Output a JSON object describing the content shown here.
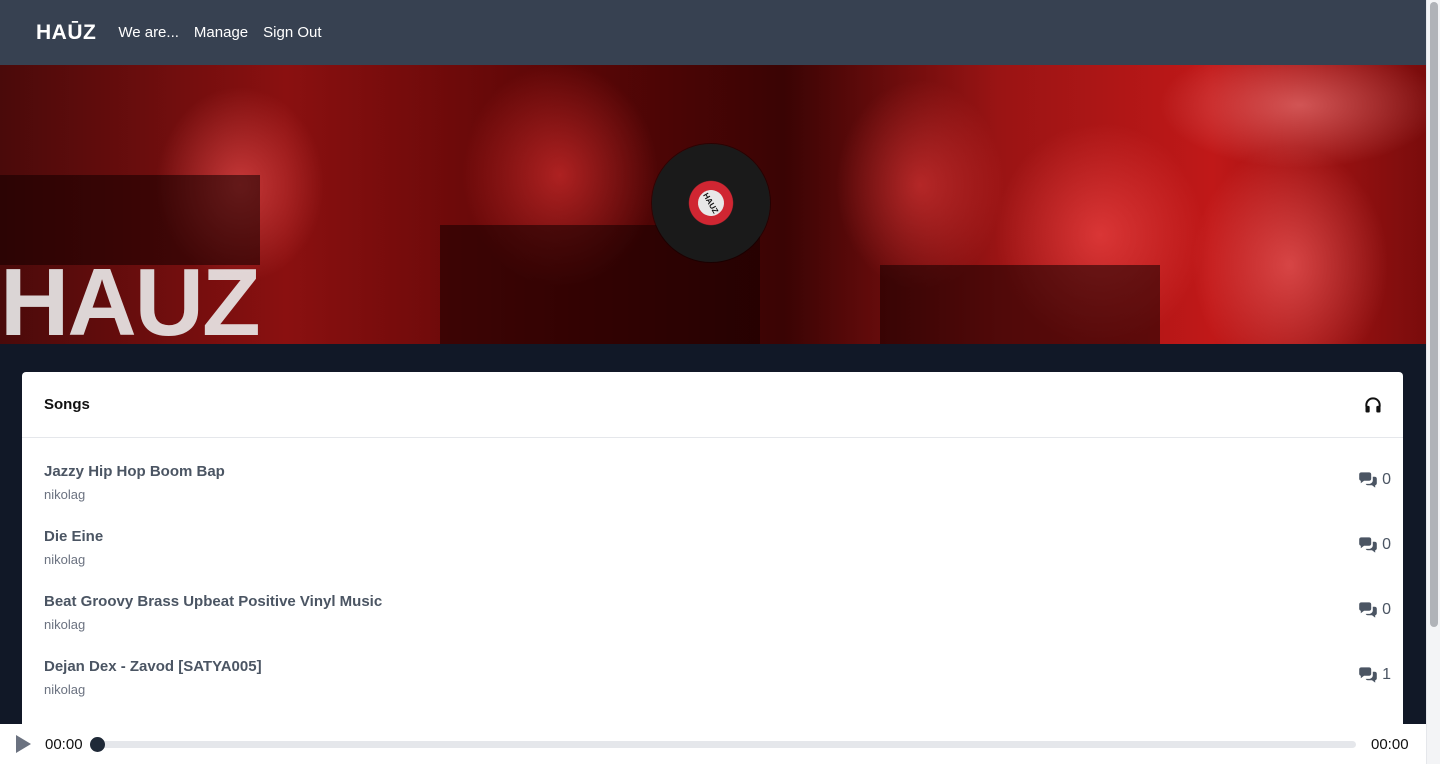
{
  "nav": {
    "brand": "HAŪZ",
    "links": [
      "We are...",
      "Manage",
      "Sign Out"
    ]
  },
  "hero": {
    "logo_text": "HAUZ",
    "vinyl_label": "HAUZ"
  },
  "songs_card": {
    "title": "Songs",
    "header_icon": "headphones-icon",
    "songs": [
      {
        "title": "Jazzy Hip Hop Boom Bap",
        "artist": "nikolag",
        "comments": "0"
      },
      {
        "title": "Die Eine",
        "artist": "nikolag",
        "comments": "0"
      },
      {
        "title": "Beat Groovy Brass Upbeat Positive Vinyl Music",
        "artist": "nikolag",
        "comments": "0"
      },
      {
        "title": "Dejan Dex - Zavod [SATYA005]",
        "artist": "nikolag",
        "comments": "1"
      }
    ]
  },
  "player": {
    "current_time": "00:00",
    "total_time": "00:00",
    "progress": 0
  },
  "colors": {
    "navbar": "#374151",
    "page_bg": "#111827",
    "accent_red": "#c01818"
  }
}
